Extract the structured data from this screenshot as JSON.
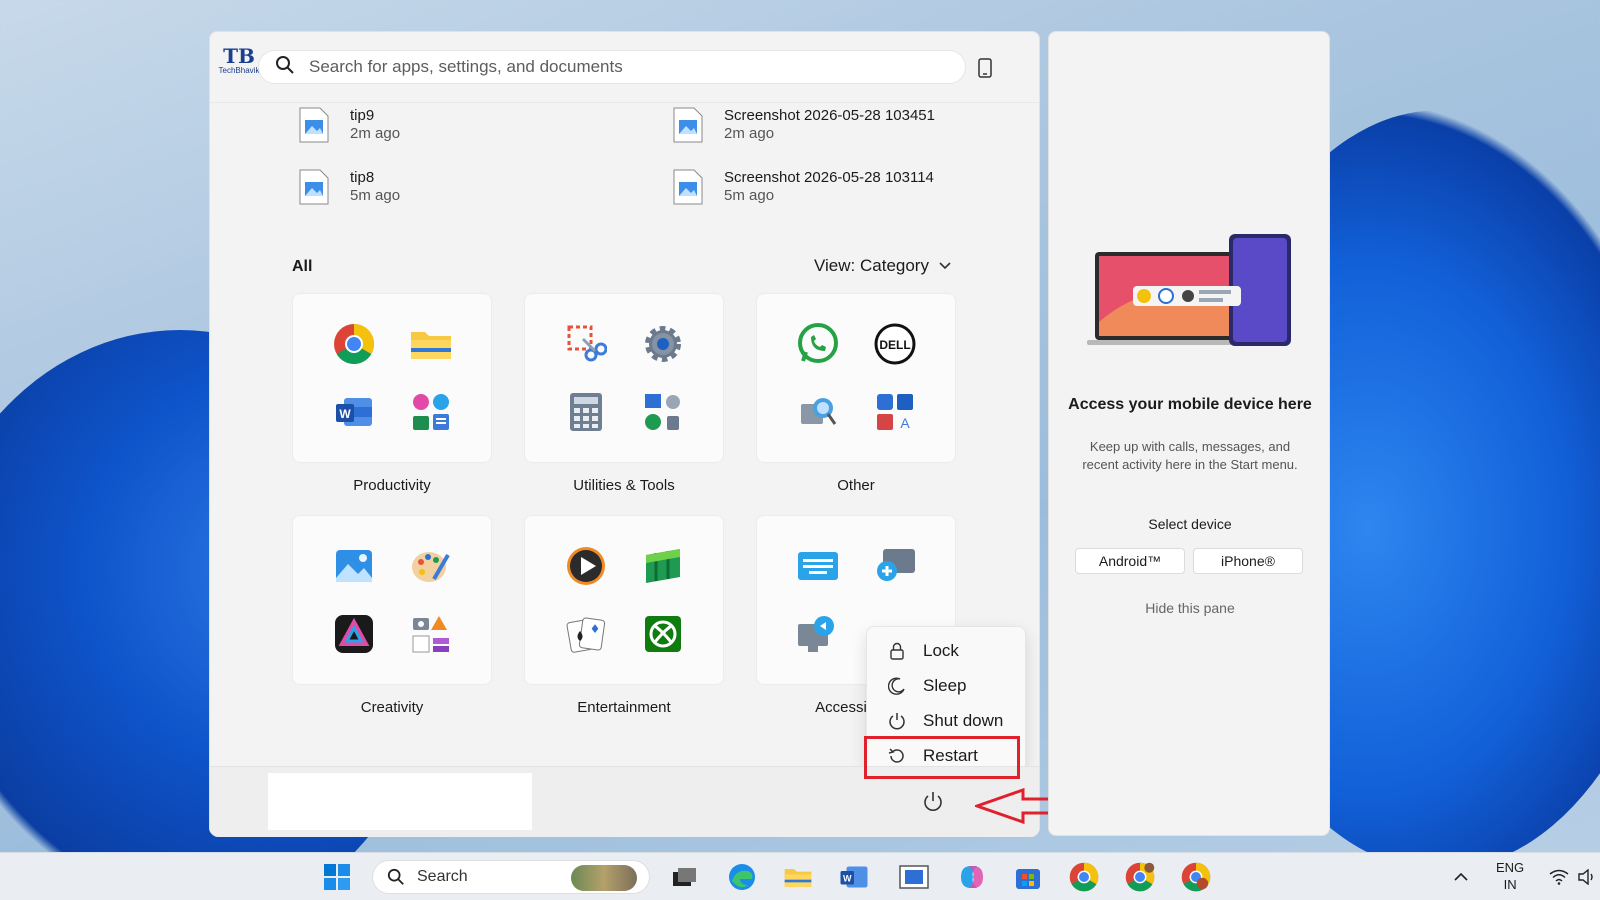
{
  "search": {
    "placeholder": "Search for apps, settings, and documents"
  },
  "logo": {
    "mark": "TB",
    "word": "TechBhavik"
  },
  "recent": [
    {
      "name": "tip9",
      "time": "2m ago"
    },
    {
      "name": "Screenshot 2026-05-28 103451",
      "time": "2m ago"
    },
    {
      "name": "tip8",
      "time": "5m ago"
    },
    {
      "name": "Screenshot 2026-05-28 103114",
      "time": "5m ago"
    }
  ],
  "all_label": "All",
  "view_label": "View: Category",
  "categories": [
    {
      "label": "Productivity",
      "apps": [
        "chrome-icon",
        "file-explorer-icon",
        "word-icon",
        "office-apps-folder-icon"
      ]
    },
    {
      "label": "Utilities & Tools",
      "apps": [
        "snipping-tool-icon",
        "settings-icon",
        "calculator-icon",
        "system-tools-folder-icon"
      ]
    },
    {
      "label": "Other",
      "apps": [
        "whatsapp-icon",
        "dell-icon",
        "quick-assist-icon",
        "other-apps-folder-icon"
      ]
    },
    {
      "label": "Creativity",
      "apps": [
        "photos-icon",
        "paint-icon",
        "clipchamp-icon",
        "creativity-folder-icon"
      ]
    },
    {
      "label": "Entertainment",
      "apps": [
        "media-player-icon",
        "solitaire-collection-icon",
        "solitaire-icon",
        "xbox-icon"
      ]
    },
    {
      "label": "Accessibility",
      "apps": [
        "on-screen-keyboard-icon",
        "magnifier-icon",
        "narrator-icon"
      ]
    }
  ],
  "power_menu": {
    "lock": "Lock",
    "sleep": "Sleep",
    "shutdown": "Shut down",
    "restart": "Restart"
  },
  "side_panel": {
    "title": "Access your mobile device here",
    "description": "Keep up with calls, messages, and recent activity here in the Start menu.",
    "select_device": "Select device",
    "android": "Android™",
    "iphone": "iPhone®",
    "hide": "Hide this pane"
  },
  "taskbar": {
    "search_placeholder": "Search",
    "lang_top": "ENG",
    "lang_bottom": "IN"
  },
  "colors": {
    "highlight": "#e0212c",
    "accent_blue": "#0067c0"
  }
}
